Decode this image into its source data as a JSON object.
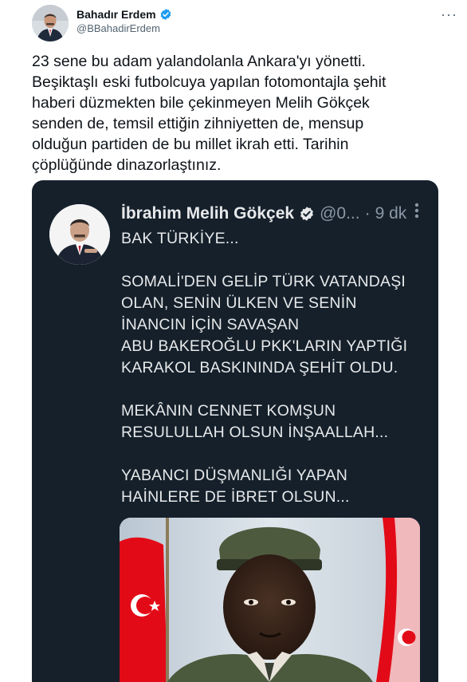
{
  "tweet": {
    "author": {
      "display_name": "Bahadır Erdem",
      "handle": "@BBahadirErdem",
      "verified": true
    },
    "more_icon": "more-horizontal-icon",
    "text": "23 sene bu adam yalandolanla Ankara'yı yönetti.\nBeşiktaşlı eski futbolcuya yapılan fotomontajla şehit\nhaberi düzmekten bile çekinmeyen Melih Gökçek\nsenden de, temsil ettiğin zihniyetten de, mensup\nolduğun partiden de bu millet ikrah etti. Tarihin\nçöplüğünde dinazorlaştınız."
  },
  "screenshot": {
    "author": {
      "display_name": "İbrahim Melih Gökçek",
      "handle": "@0...",
      "separator": "·",
      "time": "9 dk",
      "verified": true
    },
    "text": "BAK TÜRKİYE...\n\nSOMALİ'DEN GELİP TÜRK VATANDAŞI\nOLAN, SENİN ÜLKEN VE SENİN\nİNANCIN İÇİN SAVAŞAN\nABU BAKEROĞLU PKK'LARIN YAPTIĞI\nKARAKOL BASKININDA ŞEHİT OLDU.\n\nMEKÂNIN CENNET KOMŞUN\nRESULULLAH OLSUN İNŞAALLAH...\n\nYABANCI DÜŞMANLIĞI YAPAN\nHAİNLERE DE İBRET OLSUN..."
  },
  "colors": {
    "text_primary": "#0f1419",
    "text_secondary": "#536471",
    "verified_blue": "#1d9bf0",
    "dark_bg": "#15202b",
    "dark_text": "#e7e9ea",
    "dark_muted": "#8b98a5",
    "flag_red": "#e30a17"
  }
}
